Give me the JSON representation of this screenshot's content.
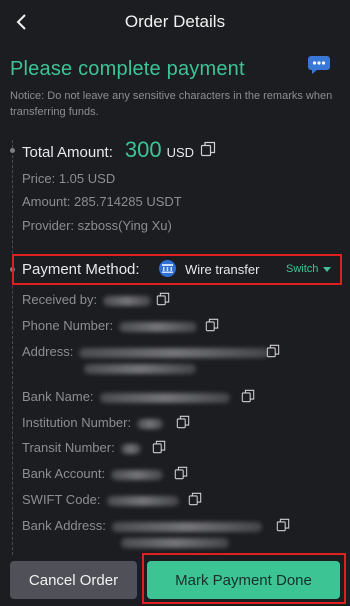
{
  "header": {
    "title": "Order Details"
  },
  "status_title": "Please complete payment",
  "notice": "Notice: Do not leave any sensitive characters in the remarks when transferring funds.",
  "order": {
    "total_label": "Total Amount:",
    "total_value": "300",
    "total_unit": "USD",
    "price": "Price: 1.05 USD",
    "amount": "Amount: 285.714285 USDT",
    "provider": "Provider: szboss(Ying Xu)"
  },
  "payment": {
    "label": "Payment Method:",
    "method": "Wire transfer",
    "switch_label": "Switch"
  },
  "details": {
    "received_by": "Received by:",
    "phone": "Phone Number:",
    "address": "Address:",
    "bank_name": "Bank Name:",
    "institution": "Institution Number:",
    "transit": "Transit Number:",
    "account": "Bank Account:",
    "swift": "SWIFT Code:",
    "bank_address": "Bank Address:"
  },
  "actions": {
    "cancel": "Cancel Order",
    "done": "Mark Payment Done"
  },
  "colors": {
    "accent": "#3cc495",
    "highlight": "#e02020",
    "background": "#1c1d21"
  }
}
